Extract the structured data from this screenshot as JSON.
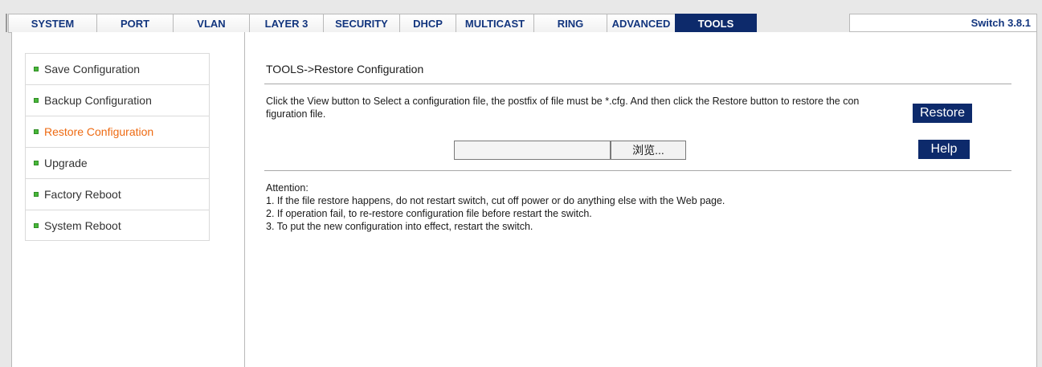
{
  "nav": {
    "tabs": [
      {
        "label": "SYSTEM",
        "active": false
      },
      {
        "label": "PORT",
        "active": false
      },
      {
        "label": "VLAN",
        "active": false
      },
      {
        "label": "LAYER 3",
        "active": false
      },
      {
        "label": "SECURITY",
        "active": false
      },
      {
        "label": "DHCP",
        "active": false
      },
      {
        "label": "MULTICAST",
        "active": false
      },
      {
        "label": "RING",
        "active": false
      },
      {
        "label": "ADVANCED",
        "active": false
      },
      {
        "label": "TOOLS",
        "active": true
      }
    ],
    "version": "Switch 3.8.1"
  },
  "sidebar": {
    "items": [
      {
        "label": "Save Configuration",
        "active": false
      },
      {
        "label": "Backup Configuration",
        "active": false
      },
      {
        "label": "Restore Configuration",
        "active": true
      },
      {
        "label": "Upgrade",
        "active": false
      },
      {
        "label": "Factory Reboot",
        "active": false
      },
      {
        "label": "System Reboot",
        "active": false
      }
    ]
  },
  "main": {
    "breadcrumb": "TOOLS->Restore Configuration",
    "instruction": "Click the View button to Select a configuration file, the postfix of file must be *.cfg. And then click the Restore button to restore the configuration file.",
    "file_input": {
      "value": "",
      "browse_label": "浏览..."
    },
    "restore_label": "Restore",
    "help_label": "Help",
    "attention": {
      "title": "Attention:",
      "lines": [
        "1. If the file restore happens, do not restart switch, cut off power or do anything else with the Web page.",
        "2. If operation fail, to re-restore configuration file before restart the switch.",
        "3. To put the new configuration into effect, restart the switch."
      ]
    }
  },
  "colors": {
    "accent_navy": "#0d2a6b",
    "nav_text": "#12357e",
    "active_sidebar_text": "#ee6a12",
    "bullet_green": "#48b73a"
  }
}
